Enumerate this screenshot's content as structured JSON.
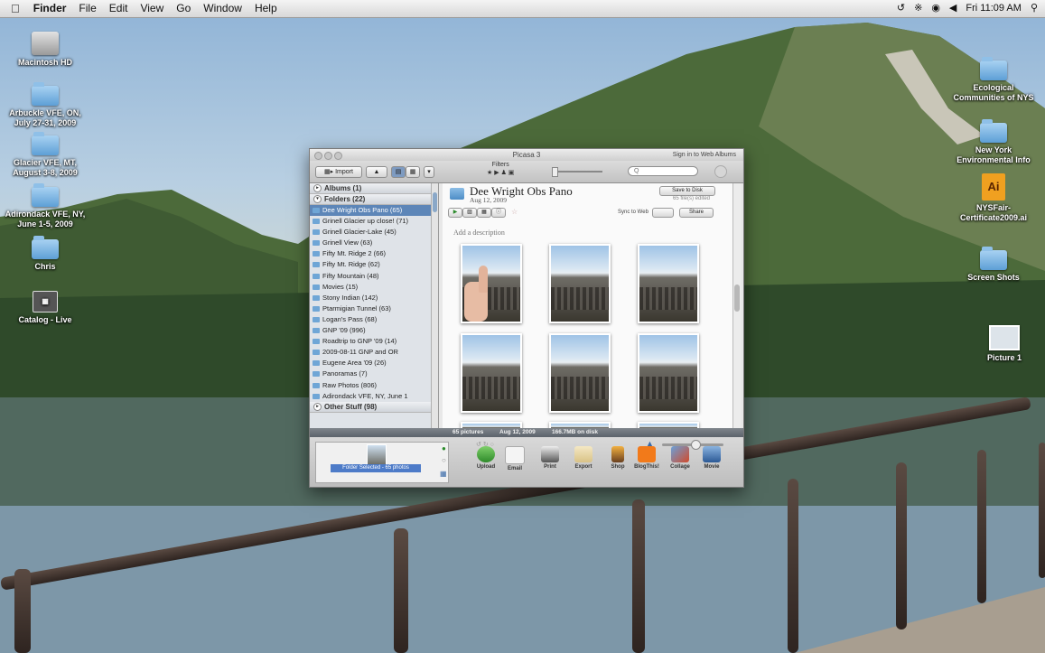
{
  "menubar": {
    "apple_icon": "apple-icon",
    "app": "Finder",
    "items": [
      "File",
      "Edit",
      "View",
      "Go",
      "Window",
      "Help"
    ],
    "status_icons": [
      "time-machine-icon",
      "bluetooth-icon",
      "wifi-icon",
      "volume-icon"
    ],
    "clock": "Fri 11:09 AM",
    "spotlight_icon": "search-icon"
  },
  "desktop": {
    "left_icons": [
      {
        "label": "Macintosh HD",
        "icon": "hard-drive-icon"
      },
      {
        "label": "Arbuckle VFE, ON, July 27-31, 2009",
        "icon": "folder-icon"
      },
      {
        "label": "Glacier VFE, MT, August 3-8, 2009",
        "icon": "folder-icon"
      },
      {
        "label": "Adirondack VFE, NY, June 1-5, 2009",
        "icon": "folder-icon"
      },
      {
        "label": "Chris",
        "icon": "folder-icon"
      },
      {
        "label": "Catalog - Live",
        "icon": "catalog-icon"
      }
    ],
    "right_icons": [
      {
        "label": "Ecological Communities of NYS",
        "icon": "folder-icon"
      },
      {
        "label": "New York Environmental Info",
        "icon": "folder-icon"
      },
      {
        "label": "NYSFair-Certificate2009.ai",
        "icon": "illustrator-file-icon"
      },
      {
        "label": "Screen Shots",
        "icon": "folder-icon"
      },
      {
        "label": "Picture 1",
        "icon": "image-file-icon"
      }
    ]
  },
  "window": {
    "title": "Picasa 3",
    "sign_in": "Sign in to Web Albums",
    "toolbar": {
      "import_label": "Import",
      "filters_label": "Filters",
      "search_placeholder": "Q"
    },
    "sidebar": {
      "albums_header": "Albums (1)",
      "folders_header": "Folders (22)",
      "other_header": "Other Stuff (98)",
      "folders": [
        {
          "label": "Dee Wright Obs Pano (65)",
          "selected": true
        },
        {
          "label": "Grinell Glacier up close! (71)",
          "selected": false
        },
        {
          "label": "Grinell Glacier-Lake (45)",
          "selected": false
        },
        {
          "label": "Grinell View (63)",
          "selected": false
        },
        {
          "label": "Fifty Mt. Ridge 2 (66)",
          "selected": false
        },
        {
          "label": "Fifty Mt. Ridge (62)",
          "selected": false
        },
        {
          "label": "Fifty Mountain (48)",
          "selected": false
        },
        {
          "label": "Movies (15)",
          "selected": false
        },
        {
          "label": "Stony Indian (142)",
          "selected": false
        },
        {
          "label": "Ptarmigian Tunnel (63)",
          "selected": false
        },
        {
          "label": "Logan's Pass (68)",
          "selected": false
        },
        {
          "label": "GNP '09 (996)",
          "selected": false
        },
        {
          "label": "Roadtrip to GNP '09 (14)",
          "selected": false
        },
        {
          "label": "2009-08-11 GNP and OR",
          "selected": false
        },
        {
          "label": "Eugene Area '09 (26)",
          "selected": false
        },
        {
          "label": "Panoramas (7)",
          "selected": false
        },
        {
          "label": "Raw Photos (806)",
          "selected": false
        },
        {
          "label": "Adirondack VFE, NY, June 1",
          "selected": false
        }
      ]
    },
    "album": {
      "title": "Dee Wright Obs Pano",
      "date": "Aug 12, 2009",
      "save_to_disk": "Save to Disk",
      "edited": "65 file(s) edited",
      "sync_to_web": "Sync to Web",
      "share": "Share",
      "add_description": "Add a description"
    },
    "status": {
      "count": "65 pictures",
      "date": "Aug 12, 2009",
      "size": "166.7MB on disk"
    },
    "tray": {
      "selection": "Folder Selected - 65 photos",
      "actions": [
        "Upload",
        "Email",
        "Print",
        "Export",
        "Shop",
        "BlogThis!",
        "Collage",
        "Movie"
      ]
    }
  },
  "colors": {
    "selection_blue": "#5d86b8",
    "tray_selection": "#4d7bc8",
    "status_bar": "#6a7078"
  }
}
